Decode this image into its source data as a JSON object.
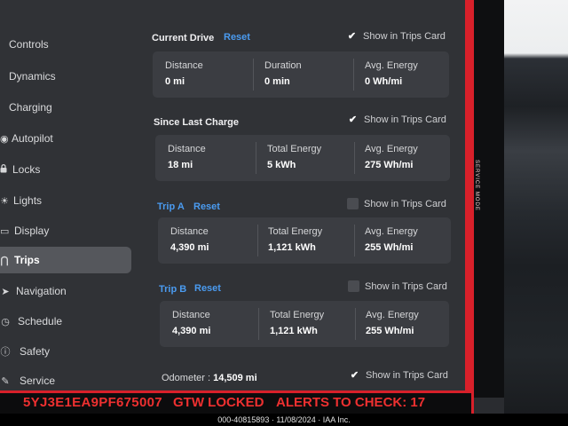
{
  "sidebar": {
    "items": [
      {
        "label": "Controls",
        "icon": "car-icon",
        "glyph": ""
      },
      {
        "label": "Dynamics",
        "icon": "dynamics-icon",
        "glyph": ""
      },
      {
        "label": "Charging",
        "icon": "charging-icon",
        "glyph": ""
      },
      {
        "label": "Autopilot",
        "icon": "steering-wheel-icon",
        "glyph": "◉"
      },
      {
        "label": "Locks",
        "icon": "lock-icon",
        "glyph": "🔒"
      },
      {
        "label": "Lights",
        "icon": "light-icon",
        "glyph": "☀"
      },
      {
        "label": "Display",
        "icon": "display-icon",
        "glyph": "▭"
      },
      {
        "label": "Trips",
        "icon": "trips-icon",
        "glyph": "⋂"
      },
      {
        "label": "Navigation",
        "icon": "navigation-icon",
        "glyph": "➤"
      },
      {
        "label": "Schedule",
        "icon": "clock-icon",
        "glyph": "◷"
      },
      {
        "label": "Safety",
        "icon": "safety-icon",
        "glyph": "ⓘ"
      },
      {
        "label": "Service",
        "icon": "wrench-icon",
        "glyph": "✎"
      }
    ],
    "active": "Trips"
  },
  "current_drive": {
    "title": "Current Drive",
    "reset": "Reset",
    "show_in_trips_card": "Show in Trips Card",
    "show_checked": true,
    "stats": [
      {
        "label": "Distance",
        "value": "0 mi"
      },
      {
        "label": "Duration",
        "value": "0 min"
      },
      {
        "label": "Avg. Energy",
        "value": "0 Wh/mi"
      }
    ]
  },
  "since_last_charge": {
    "title": "Since Last Charge",
    "show_in_trips_card": "Show in Trips Card",
    "show_checked": true,
    "stats": [
      {
        "label": "Distance",
        "value": "18 mi"
      },
      {
        "label": "Total Energy",
        "value": "5 kWh"
      },
      {
        "label": "Avg. Energy",
        "value": "275 Wh/mi"
      }
    ]
  },
  "trip_a": {
    "title": "Trip A",
    "reset": "Reset",
    "show_in_trips_card": "Show in Trips Card",
    "show_checked": false,
    "stats": [
      {
        "label": "Distance",
        "value": "4,390 mi"
      },
      {
        "label": "Total Energy",
        "value": "1,121 kWh"
      },
      {
        "label": "Avg. Energy",
        "value": "255 Wh/mi"
      }
    ]
  },
  "trip_b": {
    "title": "Trip B",
    "reset": "Reset",
    "show_in_trips_card": "Show in Trips Card",
    "show_checked": false,
    "stats": [
      {
        "label": "Distance",
        "value": "4,390 mi"
      },
      {
        "label": "Total Energy",
        "value": "1,121 kWh"
      },
      {
        "label": "Avg. Energy",
        "value": "255 Wh/mi"
      }
    ]
  },
  "odometer": {
    "label": "Odometer :",
    "value": "14,509 mi",
    "show_in_trips_card": "Show in Trips Card",
    "show_checked": true
  },
  "service_mode": {
    "text": "SERVICE MODE"
  },
  "status_bar": {
    "vin": "5YJ3E1EA9PF675007",
    "gtw": "GTW LOCKED",
    "alerts": "ALERTS TO CHECK: 17"
  },
  "caption": "000-40815893 · 11/08/2024 · IAA Inc.",
  "colors": {
    "accent": "#4a9bf0",
    "alert": "#ee3030",
    "frame": "#d8202a"
  }
}
